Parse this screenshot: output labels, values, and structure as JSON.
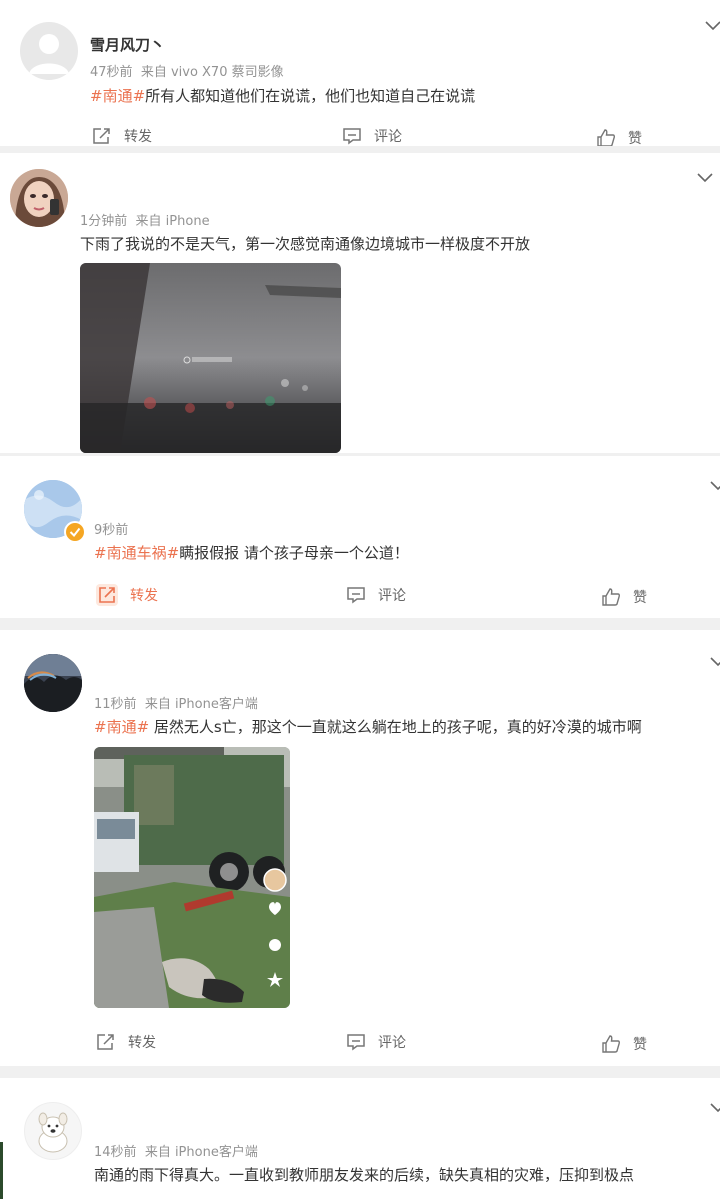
{
  "posts": [
    {
      "author": "雪月风刀丶",
      "time": "47秒前",
      "source": "来自 vivo X70 蔡司影像",
      "tag": "#南通#",
      "body": "所有人都知道他们在说谎，他们也知道自己在说谎",
      "actions": {
        "repost": "转发",
        "comment": "评论",
        "like": "赞"
      }
    },
    {
      "author": "",
      "time": "1分钟前",
      "source": "来自 iPhone",
      "tag": "",
      "body": "下雨了我说的不是天气，第一次感觉南通像边境城市一样极度不开放",
      "actions": {
        "repost": "",
        "comment": "",
        "like": ""
      }
    },
    {
      "author": "",
      "time": "9秒前",
      "source": "",
      "tag": "#南通车祸#",
      "body": "瞒报假报 请个孩子母亲一个公道！",
      "actions": {
        "repost": "转发",
        "comment": "评论",
        "like": "赞"
      }
    },
    {
      "author": "",
      "time": "11秒前",
      "source": "来自 iPhone客户端",
      "tag": "#南通#",
      "body": " 居然无人s亡，那这个一直就这么躺在地上的孩子呢，真的好冷漠的城市啊",
      "actions": {
        "repost": "转发",
        "comment": "评论",
        "like": "赞"
      }
    },
    {
      "author": "",
      "time": "14秒前",
      "source": "来自 iPhone客户端",
      "tag": "",
      "body": "南通的雨下得真大。一直收到教师朋友发来的后续，缺失真相的灾难，压抑到极点"
    }
  ],
  "colors": {
    "tag": "#eb7350",
    "meta": "#939393",
    "background": "#f0f0f0"
  },
  "icons": [
    "chevron-down-icon",
    "repost-icon",
    "comment-icon",
    "like-icon"
  ]
}
